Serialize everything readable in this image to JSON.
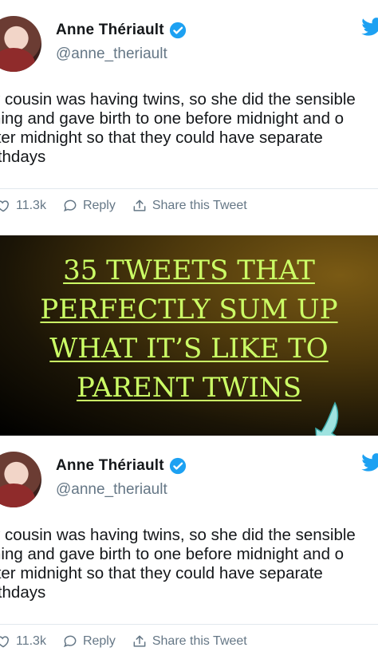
{
  "tweets": [
    {
      "name": "Anne Thériault",
      "handle": "@anne_theriault",
      "text_lines": [
        "y cousin was having twins, so she did the sensible",
        "ning and gave birth to one before midnight and o",
        "fter midnight so that they could have separate",
        "rthdays"
      ],
      "likes": "11.3k",
      "reply_label": "Reply",
      "share_label": "Share this Tweet"
    },
    {
      "name": "Anne Thériault",
      "handle": "@anne_theriault",
      "text_lines": [
        "y cousin was having twins, so she did the sensible",
        "ning and gave birth to one before midnight and o",
        "fter midnight so that they could have separate",
        "rthdays"
      ],
      "likes": "11.3k",
      "reply_label": "Reply",
      "share_label": "Share this Tweet"
    }
  ],
  "banner": {
    "headline_lines": [
      "35 TWEETS THAT",
      "PERFECTLY SUM UP",
      "WHAT IT’S LIKE TO",
      "PARENT TWINS"
    ],
    "text_color": "#ccff66"
  },
  "colors": {
    "verified": "#1da1f2",
    "twitter": "#1da1f2",
    "muted": "#657786"
  },
  "icons": {
    "verified": "verified-badge-icon",
    "bird": "twitter-bird-icon",
    "heart": "heart-icon",
    "reply": "reply-bubble-icon",
    "share": "share-icon",
    "arrow": "arrow-down-icon"
  }
}
